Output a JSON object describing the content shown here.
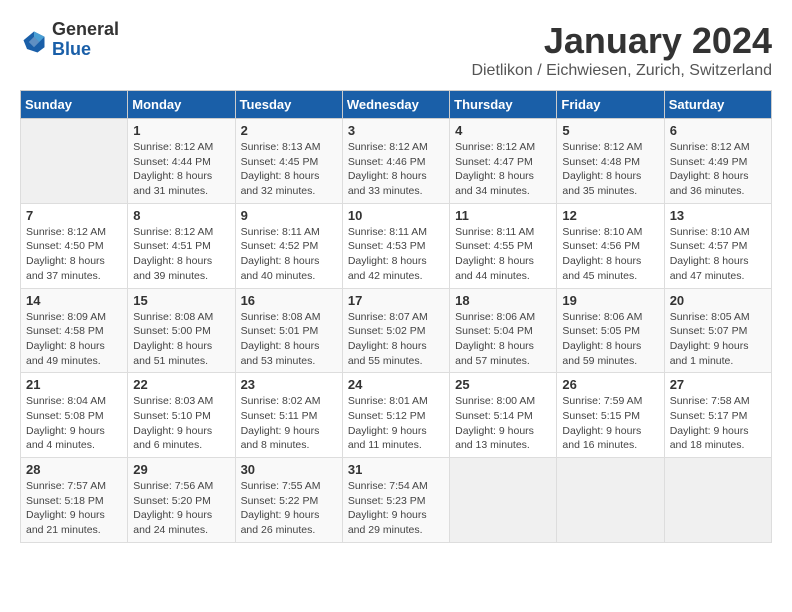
{
  "header": {
    "logo_general": "General",
    "logo_blue": "Blue",
    "month_year": "January 2024",
    "location": "Dietlikon / Eichwiesen, Zurich, Switzerland"
  },
  "days_of_week": [
    "Sunday",
    "Monday",
    "Tuesday",
    "Wednesday",
    "Thursday",
    "Friday",
    "Saturday"
  ],
  "weeks": [
    [
      {
        "day": "",
        "detail": ""
      },
      {
        "day": "1",
        "detail": "Sunrise: 8:12 AM\nSunset: 4:44 PM\nDaylight: 8 hours\nand 31 minutes."
      },
      {
        "day": "2",
        "detail": "Sunrise: 8:13 AM\nSunset: 4:45 PM\nDaylight: 8 hours\nand 32 minutes."
      },
      {
        "day": "3",
        "detail": "Sunrise: 8:12 AM\nSunset: 4:46 PM\nDaylight: 8 hours\nand 33 minutes."
      },
      {
        "day": "4",
        "detail": "Sunrise: 8:12 AM\nSunset: 4:47 PM\nDaylight: 8 hours\nand 34 minutes."
      },
      {
        "day": "5",
        "detail": "Sunrise: 8:12 AM\nSunset: 4:48 PM\nDaylight: 8 hours\nand 35 minutes."
      },
      {
        "day": "6",
        "detail": "Sunrise: 8:12 AM\nSunset: 4:49 PM\nDaylight: 8 hours\nand 36 minutes."
      }
    ],
    [
      {
        "day": "7",
        "detail": "Sunrise: 8:12 AM\nSunset: 4:50 PM\nDaylight: 8 hours\nand 37 minutes."
      },
      {
        "day": "8",
        "detail": "Sunrise: 8:12 AM\nSunset: 4:51 PM\nDaylight: 8 hours\nand 39 minutes."
      },
      {
        "day": "9",
        "detail": "Sunrise: 8:11 AM\nSunset: 4:52 PM\nDaylight: 8 hours\nand 40 minutes."
      },
      {
        "day": "10",
        "detail": "Sunrise: 8:11 AM\nSunset: 4:53 PM\nDaylight: 8 hours\nand 42 minutes."
      },
      {
        "day": "11",
        "detail": "Sunrise: 8:11 AM\nSunset: 4:55 PM\nDaylight: 8 hours\nand 44 minutes."
      },
      {
        "day": "12",
        "detail": "Sunrise: 8:10 AM\nSunset: 4:56 PM\nDaylight: 8 hours\nand 45 minutes."
      },
      {
        "day": "13",
        "detail": "Sunrise: 8:10 AM\nSunset: 4:57 PM\nDaylight: 8 hours\nand 47 minutes."
      }
    ],
    [
      {
        "day": "14",
        "detail": "Sunrise: 8:09 AM\nSunset: 4:58 PM\nDaylight: 8 hours\nand 49 minutes."
      },
      {
        "day": "15",
        "detail": "Sunrise: 8:08 AM\nSunset: 5:00 PM\nDaylight: 8 hours\nand 51 minutes."
      },
      {
        "day": "16",
        "detail": "Sunrise: 8:08 AM\nSunset: 5:01 PM\nDaylight: 8 hours\nand 53 minutes."
      },
      {
        "day": "17",
        "detail": "Sunrise: 8:07 AM\nSunset: 5:02 PM\nDaylight: 8 hours\nand 55 minutes."
      },
      {
        "day": "18",
        "detail": "Sunrise: 8:06 AM\nSunset: 5:04 PM\nDaylight: 8 hours\nand 57 minutes."
      },
      {
        "day": "19",
        "detail": "Sunrise: 8:06 AM\nSunset: 5:05 PM\nDaylight: 8 hours\nand 59 minutes."
      },
      {
        "day": "20",
        "detail": "Sunrise: 8:05 AM\nSunset: 5:07 PM\nDaylight: 9 hours\nand 1 minute."
      }
    ],
    [
      {
        "day": "21",
        "detail": "Sunrise: 8:04 AM\nSunset: 5:08 PM\nDaylight: 9 hours\nand 4 minutes."
      },
      {
        "day": "22",
        "detail": "Sunrise: 8:03 AM\nSunset: 5:10 PM\nDaylight: 9 hours\nand 6 minutes."
      },
      {
        "day": "23",
        "detail": "Sunrise: 8:02 AM\nSunset: 5:11 PM\nDaylight: 9 hours\nand 8 minutes."
      },
      {
        "day": "24",
        "detail": "Sunrise: 8:01 AM\nSunset: 5:12 PM\nDaylight: 9 hours\nand 11 minutes."
      },
      {
        "day": "25",
        "detail": "Sunrise: 8:00 AM\nSunset: 5:14 PM\nDaylight: 9 hours\nand 13 minutes."
      },
      {
        "day": "26",
        "detail": "Sunrise: 7:59 AM\nSunset: 5:15 PM\nDaylight: 9 hours\nand 16 minutes."
      },
      {
        "day": "27",
        "detail": "Sunrise: 7:58 AM\nSunset: 5:17 PM\nDaylight: 9 hours\nand 18 minutes."
      }
    ],
    [
      {
        "day": "28",
        "detail": "Sunrise: 7:57 AM\nSunset: 5:18 PM\nDaylight: 9 hours\nand 21 minutes."
      },
      {
        "day": "29",
        "detail": "Sunrise: 7:56 AM\nSunset: 5:20 PM\nDaylight: 9 hours\nand 24 minutes."
      },
      {
        "day": "30",
        "detail": "Sunrise: 7:55 AM\nSunset: 5:22 PM\nDaylight: 9 hours\nand 26 minutes."
      },
      {
        "day": "31",
        "detail": "Sunrise: 7:54 AM\nSunset: 5:23 PM\nDaylight: 9 hours\nand 29 minutes."
      },
      {
        "day": "",
        "detail": ""
      },
      {
        "day": "",
        "detail": ""
      },
      {
        "day": "",
        "detail": ""
      }
    ]
  ]
}
